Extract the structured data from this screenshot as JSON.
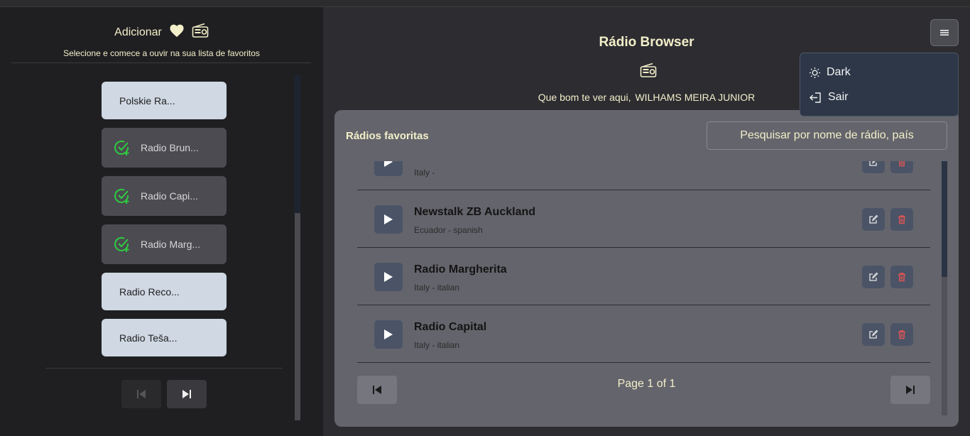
{
  "colors": {
    "accent_text": "#f3efc9",
    "check_green": "#2ecc40",
    "delete_red": "#e05555",
    "panel_bg": "#64646c"
  },
  "sidebar": {
    "title": "Adicionar",
    "title_icons": [
      "heart-icon",
      "radio-icon"
    ],
    "subtitle": "Selecione e comece a ouvir na sua lista de favoritos",
    "items": [
      {
        "label": "Polskie Ra...",
        "added": false
      },
      {
        "label": "Radio Brun...",
        "added": true
      },
      {
        "label": "Radio Capi...",
        "added": true
      },
      {
        "label": "Radio Marg...",
        "added": true
      },
      {
        "label": "Radio Reco...",
        "added": false
      },
      {
        "label": "Radio Teša...",
        "added": false
      }
    ],
    "pagination": {
      "prev_icon": "skip-previous-icon",
      "next_icon": "skip-next-icon"
    }
  },
  "header": {
    "title": "Rádio Browser",
    "welcome": "Que bom te ver aqui,",
    "user_name": "WILHAMS MEIRA JUNIOR"
  },
  "menu": {
    "items": [
      {
        "label": "Dark",
        "icon": "sun-icon"
      },
      {
        "label": "Sair",
        "icon": "logout-icon"
      }
    ]
  },
  "favorites": {
    "title": "Rádios favoritas",
    "search_placeholder": "Pesquisar por nome de rádio, país",
    "rows": [
      {
        "name": "",
        "meta": "Italy -"
      },
      {
        "name": "Newstalk ZB Auckland",
        "meta": "Ecuador - spanish"
      },
      {
        "name": "Radio Margherita",
        "meta": "Italy - italian"
      },
      {
        "name": "Radio Capital",
        "meta": "Italy - italian"
      }
    ],
    "page_label": "Page 1 of 1"
  }
}
